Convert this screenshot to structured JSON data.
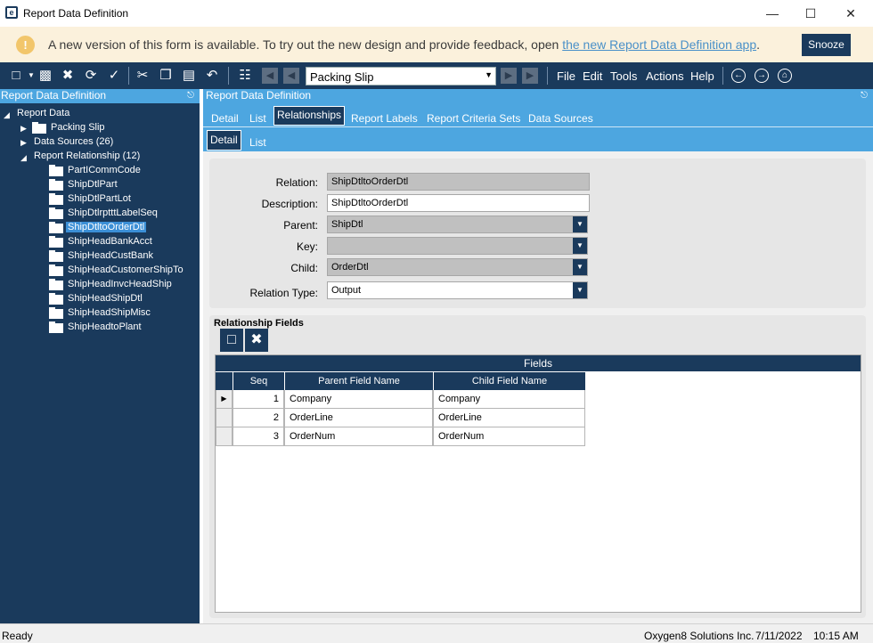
{
  "window": {
    "title": "Report Data Definition",
    "app_icon": "e",
    "minimize_icon": "minimize-icon",
    "maximize_icon": "maximize-icon",
    "close_icon": "close-icon"
  },
  "banner": {
    "text": "A new version of this form is available. To try out the new design and provide feedback, open ",
    "link_text": "the new Report Data Definition app",
    "trailing": ".",
    "snooze_label": "Snooze",
    "icon": "!"
  },
  "toolbar": {
    "report_select_value": "Packing Slip",
    "menu": [
      "File",
      "Edit",
      "Tools",
      "Actions",
      "Help"
    ]
  },
  "left_panel": {
    "title": "Report Data Definition",
    "root": "Report Data",
    "packing_slip": "Packing Slip",
    "data_sources": "Data Sources (26)",
    "report_relationship": "Report Relationship (12)",
    "relationships": [
      "PartICommCode",
      "ShipDtlPart",
      "ShipDtlPartLot",
      "ShipDtlrptttLabelSeq",
      "ShipDtltoOrderDtl",
      "ShipHeadBankAcct",
      "ShipHeadCustBank",
      "ShipHeadCustomerShipTo",
      "ShipHeadInvcHeadShip",
      "ShipHeadShipDtl",
      "ShipHeadShipMisc",
      "ShipHeadtoPlant"
    ]
  },
  "right_panel": {
    "title": "Report Data Definition",
    "tabs": [
      "Detail",
      "List",
      "Relationships",
      "Report Labels",
      "Report Criteria Sets",
      "Data Sources"
    ],
    "subtabs": [
      "Detail",
      "List"
    ]
  },
  "form": {
    "relation_label": "Relation:",
    "relation_value": "ShipDtltoOrderDtl",
    "description_label": "Description:",
    "description_value": "ShipDtltoOrderDtl",
    "parent_label": "Parent:",
    "parent_value": "ShipDtl",
    "key_label": "Key:",
    "key_value": "",
    "child_label": "Child:",
    "child_value": "OrderDtl",
    "relation_type_label": "Relation Type:",
    "relation_type_value": "Output"
  },
  "relationship_fields": {
    "title": "Relationship Fields",
    "band": "Fields",
    "columns": [
      "Seq",
      "Parent Field Name",
      "Child Field Name"
    ],
    "rows": [
      {
        "seq": "1",
        "parent": "Company",
        "child": "Company"
      },
      {
        "seq": "2",
        "parent": "OrderLine",
        "child": "OrderLine"
      },
      {
        "seq": "3",
        "parent": "OrderNum",
        "child": "OrderNum"
      }
    ]
  },
  "status": {
    "left": "Ready",
    "company": "Oxygen8 Solutions Inc.",
    "date": "7/11/2022",
    "time": "10:15 AM"
  }
}
